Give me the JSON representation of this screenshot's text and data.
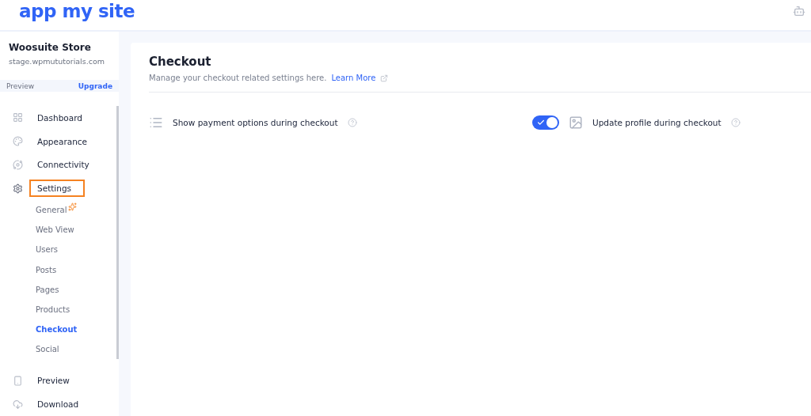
{
  "header": {
    "logo": "app my site"
  },
  "store": {
    "name": "Woosuite Store",
    "domain": "stage.wpmututorials.com",
    "preview": "Preview",
    "upgrade": "Upgrade"
  },
  "nav": [
    {
      "label": "Dashboard",
      "highlighted": false,
      "selected": false
    },
    {
      "label": "Appearance",
      "highlighted": false,
      "selected": false
    },
    {
      "label": "Connectivity",
      "highlighted": false,
      "selected": false
    },
    {
      "label": "Settings",
      "highlighted": true,
      "selected": false,
      "children": [
        {
          "label": "General",
          "selected": false,
          "new": true
        },
        {
          "label": "Web View",
          "selected": false,
          "new": false
        },
        {
          "label": "Users",
          "selected": false,
          "new": false
        },
        {
          "label": "Posts",
          "selected": false,
          "new": false
        },
        {
          "label": "Pages",
          "selected": false,
          "new": false
        },
        {
          "label": "Products",
          "selected": false,
          "new": false
        },
        {
          "label": "Checkout",
          "selected": true,
          "new": false
        },
        {
          "label": "Social",
          "selected": false,
          "new": false
        }
      ]
    },
    {
      "label": "Preview",
      "highlighted": false,
      "selected": false
    },
    {
      "label": "Download",
      "highlighted": false,
      "selected": false
    }
  ],
  "page": {
    "title": "Checkout",
    "subtitle": "Manage your checkout related settings here.",
    "link": "Learn More",
    "options": [
      {
        "kind": "list",
        "label": "Show payment options during checkout",
        "on": true
      },
      {
        "kind": "image",
        "label": "Update profile during checkout"
      }
    ]
  }
}
